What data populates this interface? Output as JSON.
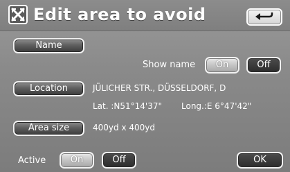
{
  "title": "Edit area to avoid",
  "icons": {
    "title_icon": "avoid-area-icon",
    "back_icon": "return-arrow-icon"
  },
  "name_section": {
    "button_label": "Name",
    "show_name_label": "Show name",
    "on_label": "On",
    "off_label": "Off",
    "selected": "On"
  },
  "location_section": {
    "button_label": "Location",
    "address": "JÜLICHER STR., DÜSSELDORF, D",
    "latitude": "Lat. :N51°14'37\"",
    "longitude": "Long.:E  6°47'42\""
  },
  "area_size_section": {
    "button_label": "Area size",
    "value": "400yd x 400yd"
  },
  "active_section": {
    "label": "Active",
    "on_label": "On",
    "off_label": "Off",
    "selected": "On"
  },
  "ok_label": "OK",
  "colors": {
    "background": "#8a8a8a",
    "button_dark": "#3c3c3c",
    "button_selected": "#c4c4c4",
    "text": "#ffffff"
  }
}
